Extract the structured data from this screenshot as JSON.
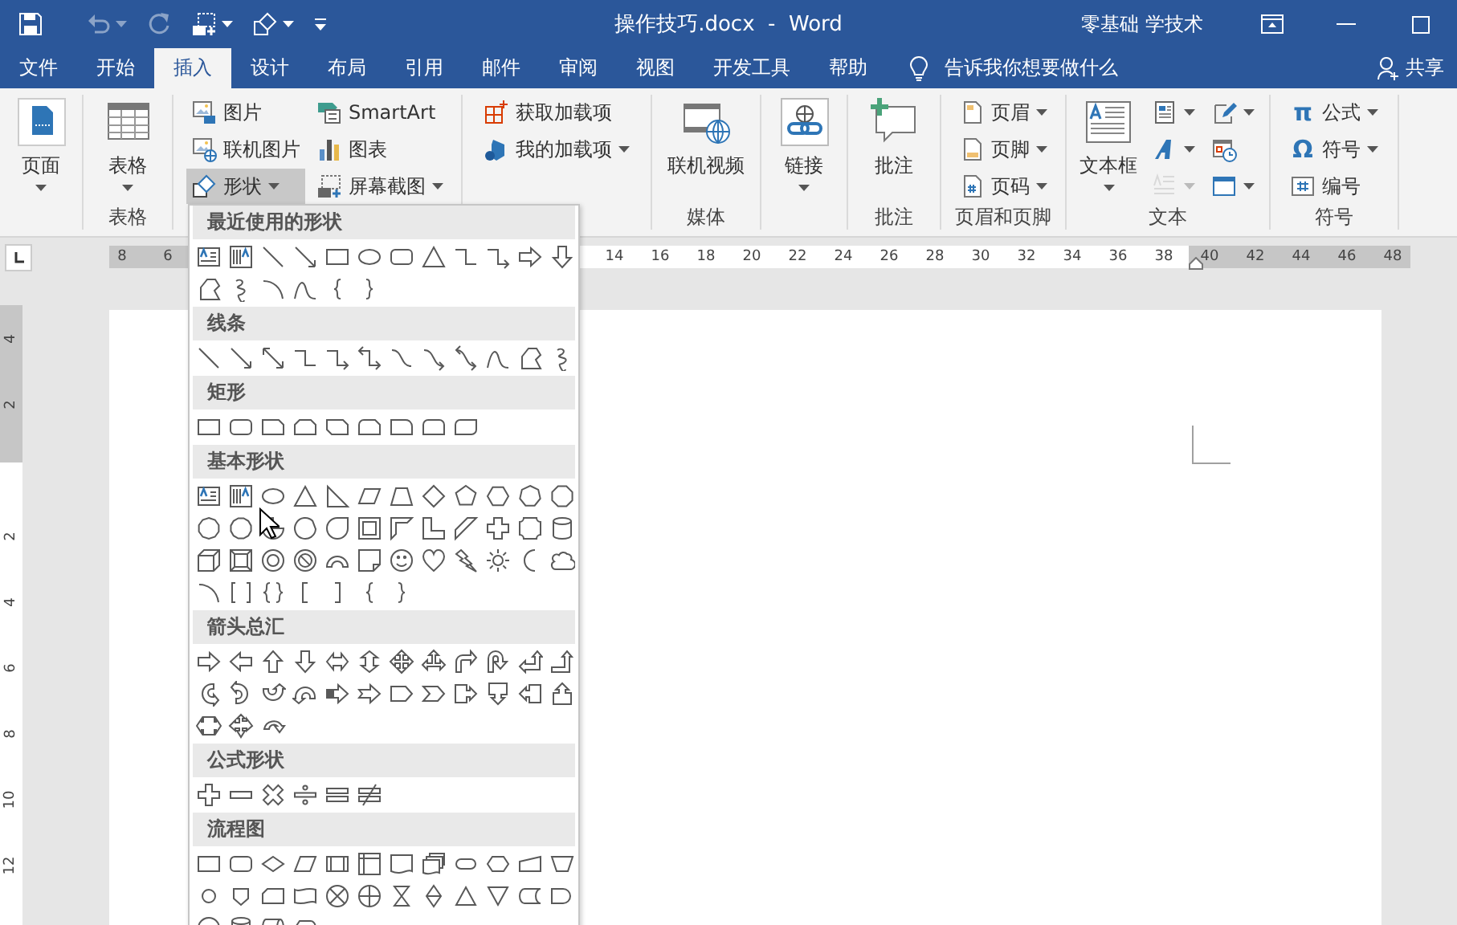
{
  "title_bar": {
    "quick_access": [
      {
        "disabled": false,
        "dropdown": false
      },
      {
        "disabled": true,
        "dropdown": true
      },
      {
        "disabled": true,
        "dropdown": false
      },
      {
        "disabled": false,
        "dropdown": true
      },
      {
        "disabled": false,
        "dropdown": true
      },
      {
        "disabled": false,
        "dropdown": false
      }
    ],
    "title": "操作技巧.docx  -  Word",
    "user": "零基础 学技术"
  },
  "tabs": [
    {
      "label": "文件",
      "selected": false
    },
    {
      "label": "开始",
      "selected": false
    },
    {
      "label": "插入",
      "selected": true
    },
    {
      "label": "设计",
      "selected": false
    },
    {
      "label": "布局",
      "selected": false
    },
    {
      "label": "引用",
      "selected": false
    },
    {
      "label": "邮件",
      "selected": false
    },
    {
      "label": "审阅",
      "selected": false
    },
    {
      "label": "视图",
      "selected": false
    },
    {
      "label": "开发工具",
      "selected": false
    },
    {
      "label": "帮助",
      "selected": false
    }
  ],
  "tell_me": "告诉我你想要做什么",
  "share": "共享",
  "ribbon": [
    {
      "items": [
        {
          "kind": "large",
          "label": "页面",
          "dropdown": true,
          "pressed": false,
          "disabled": false
        }
      ]
    },
    {
      "label": "表格",
      "items": [
        {
          "kind": "large",
          "label": "表格",
          "dropdown": true,
          "pressed": false,
          "disabled": false
        }
      ]
    },
    {
      "items": [
        {
          "kind": "small",
          "label": "图片",
          "dropdown": false,
          "pressed": false,
          "disabled": false
        },
        {
          "kind": "small",
          "label": "联机图片",
          "dropdown": false,
          "pressed": false,
          "disabled": false
        },
        {
          "kind": "small",
          "label": "形状",
          "dropdown": true,
          "pressed": true,
          "disabled": false
        },
        {
          "kind": "small",
          "label": "SmartArt",
          "dropdown": false,
          "pressed": false,
          "disabled": false
        },
        {
          "kind": "small",
          "label": "图表",
          "dropdown": false,
          "pressed": false,
          "disabled": false
        },
        {
          "kind": "small",
          "label": "屏幕截图",
          "dropdown": true,
          "pressed": false,
          "disabled": false
        }
      ]
    },
    {
      "items": [
        {
          "kind": "small",
          "label": "获取加载项",
          "dropdown": false,
          "pressed": false,
          "disabled": false
        },
        {
          "kind": "small",
          "label": "我的加载项",
          "dropdown": true,
          "pressed": false,
          "disabled": false
        }
      ]
    },
    {
      "label": "媒体",
      "items": [
        {
          "kind": "large",
          "label": "联机视频",
          "dropdown": false,
          "pressed": false,
          "disabled": false
        }
      ]
    },
    {
      "items": [
        {
          "kind": "large",
          "label": "链接",
          "dropdown": true,
          "pressed": false,
          "disabled": false
        }
      ]
    },
    {
      "label": "批注",
      "items": [
        {
          "kind": "large",
          "label": "批注",
          "dropdown": false,
          "pressed": false,
          "disabled": false
        }
      ]
    },
    {
      "label": "页眉和页脚",
      "items": [
        {
          "kind": "small",
          "label": "页眉",
          "dropdown": true,
          "pressed": false,
          "disabled": false
        },
        {
          "kind": "small",
          "label": "页脚",
          "dropdown": true,
          "pressed": false,
          "disabled": false
        },
        {
          "kind": "small",
          "label": "页码",
          "dropdown": true,
          "pressed": false,
          "disabled": false
        }
      ]
    },
    {
      "label": "文本",
      "items": [
        {
          "kind": "large",
          "label": "文本框",
          "dropdown": true,
          "pressed": false,
          "disabled": false
        },
        {
          "kind": "icon",
          "dropdown": true,
          "pressed": false,
          "disabled": false
        },
        {
          "kind": "icon",
          "dropdown": true,
          "pressed": false,
          "disabled": false
        },
        {
          "kind": "icon",
          "dropdown": true,
          "pressed": false,
          "disabled": true
        },
        {
          "kind": "icon",
          "dropdown": true,
          "pressed": false,
          "disabled": false
        },
        {
          "kind": "icon",
          "dropdown": false,
          "pressed": false,
          "disabled": false
        },
        {
          "kind": "icon",
          "dropdown": true,
          "pressed": false,
          "disabled": false
        }
      ]
    },
    {
      "label": "符号",
      "items": [
        {
          "kind": "small",
          "label": "公式",
          "icon_text": "π",
          "dropdown": true,
          "pressed": false,
          "disabled": false
        },
        {
          "kind": "small",
          "label": "符号",
          "icon_text": "Ω",
          "dropdown": true,
          "pressed": false,
          "disabled": false
        },
        {
          "kind": "small",
          "label": "编号",
          "dropdown": false,
          "pressed": false,
          "disabled": false
        }
      ]
    }
  ],
  "ruler": {
    "left_numbers": [
      "8",
      "6"
    ],
    "right_numbers": [
      "14",
      "16",
      "18",
      "20",
      "22",
      "24",
      "26",
      "28",
      "30",
      "32",
      "34",
      "36",
      "38",
      "40",
      "42",
      "44",
      "46",
      "48"
    ]
  },
  "vertical_ruler": {
    "top_numbers": [
      "4",
      "2"
    ],
    "bottom_numbers": [
      "2",
      "4",
      "6",
      "8",
      "10",
      "12"
    ]
  },
  "shapes_menu": {
    "sections": [
      {
        "title": "最近使用的形状"
      },
      {
        "title": "线条"
      },
      {
        "title": "矩形"
      },
      {
        "title": "基本形状"
      },
      {
        "title": "箭头总汇"
      },
      {
        "title": "公式形状"
      },
      {
        "title": "流程图"
      }
    ]
  }
}
